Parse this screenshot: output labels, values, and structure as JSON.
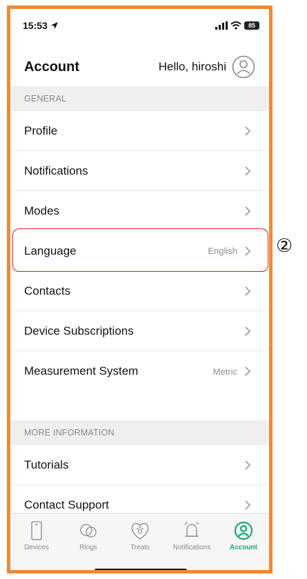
{
  "status_bar": {
    "time": "15:53",
    "battery": "85"
  },
  "header": {
    "title": "Account",
    "greeting": "Hello, hiroshi"
  },
  "sections": [
    {
      "title": "GENERAL",
      "rows": [
        {
          "label": "Profile",
          "value": ""
        },
        {
          "label": "Notifications",
          "value": ""
        },
        {
          "label": "Modes",
          "value": ""
        },
        {
          "label": "Language",
          "value": "English"
        },
        {
          "label": "Contacts",
          "value": ""
        },
        {
          "label": "Device Subscriptions",
          "value": ""
        },
        {
          "label": "Measurement System",
          "value": "Metric"
        }
      ]
    },
    {
      "title": "MORE INFORMATION",
      "rows": [
        {
          "label": "Tutorials",
          "value": ""
        },
        {
          "label": "Contact Support",
          "value": ""
        }
      ]
    }
  ],
  "annotation": {
    "step_marker": "②",
    "highlight_color": "#e01b24"
  },
  "tabs": [
    {
      "label": "Devices",
      "icon": "phone-icon",
      "active": false
    },
    {
      "label": "Rings",
      "icon": "rings-icon",
      "active": false
    },
    {
      "label": "Treats",
      "icon": "heart-paw-icon",
      "active": false
    },
    {
      "label": "Notifications",
      "icon": "bell-icon",
      "active": false
    },
    {
      "label": "Account",
      "icon": "account-icon",
      "active": true
    }
  ],
  "colors": {
    "frame": "#ee8a35",
    "accent": "#1aa876",
    "section_bg": "#efefef"
  }
}
